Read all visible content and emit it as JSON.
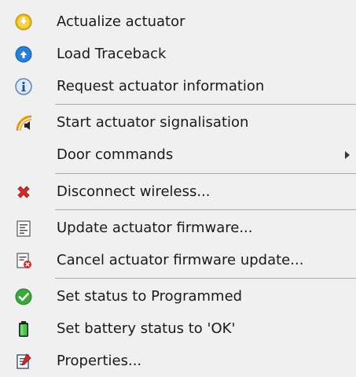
{
  "menu": {
    "items": [
      {
        "label": "Actualize actuator",
        "icon": "yellow-down-circle-icon"
      },
      {
        "label": "Load Traceback",
        "icon": "blue-up-circle-icon"
      },
      {
        "label": "Request actuator information",
        "icon": "info-icon"
      },
      {
        "label": "Start actuator signalisation",
        "icon": "speaker-icon"
      },
      {
        "label": "Door commands",
        "icon": "none",
        "has_submenu": true
      },
      {
        "label": "Disconnect wireless...",
        "icon": "red-x-icon"
      },
      {
        "label": "Update actuator firmware...",
        "icon": "document-icon"
      },
      {
        "label": "Cancel actuator firmware update...",
        "icon": "document-cancel-icon"
      },
      {
        "label": "Set status to Programmed",
        "icon": "green-check-icon"
      },
      {
        "label": "Set battery status to 'OK'",
        "icon": "battery-icon"
      },
      {
        "label": "Properties...",
        "icon": "properties-icon"
      }
    ]
  },
  "colors": {
    "background": "#f0f0f0",
    "separator": "#a9a9a9",
    "text": "#1a1a1a"
  }
}
